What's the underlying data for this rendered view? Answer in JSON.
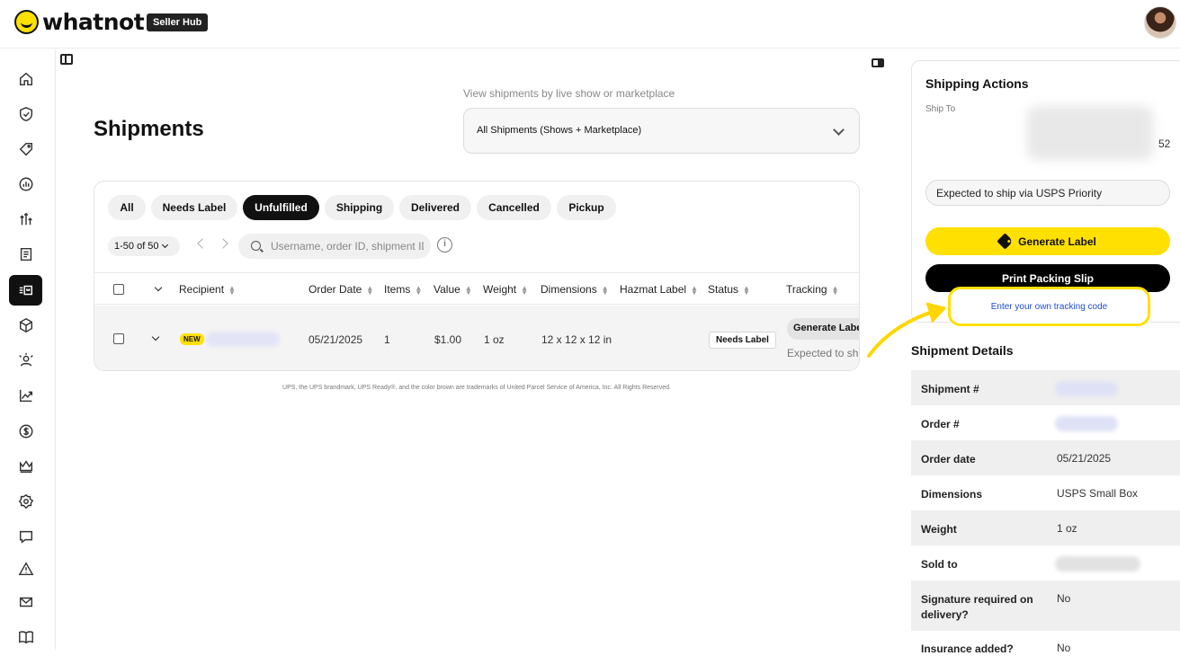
{
  "app": {
    "logo_text": "whatnot",
    "badge": "Seller Hub"
  },
  "sidebar": {
    "items": [
      {
        "icon": "home-icon"
      },
      {
        "icon": "shield-check-icon"
      },
      {
        "icon": "tag-icon"
      },
      {
        "icon": "chart-circle-icon"
      },
      {
        "icon": "arrows-up-icon"
      },
      {
        "icon": "receipt-icon"
      },
      {
        "icon": "shipments-icon",
        "active": true
      },
      {
        "icon": "box-icon"
      },
      {
        "icon": "users-icon"
      },
      {
        "icon": "trend-up-icon"
      },
      {
        "icon": "dollar-icon"
      },
      {
        "icon": "crown-icon"
      },
      {
        "icon": "gear-icon"
      },
      {
        "icon": "chat-icon"
      },
      {
        "icon": "warning-icon"
      },
      {
        "icon": "mail-icon"
      },
      {
        "icon": "book-icon"
      }
    ]
  },
  "main": {
    "title": "Shipments",
    "filter": {
      "label": "View shipments by live show or marketplace",
      "selected": "All Shipments (Shows + Marketplace)"
    },
    "tabs": [
      {
        "label": "All"
      },
      {
        "label": "Needs Label"
      },
      {
        "label": "Unfulfilled",
        "active": true
      },
      {
        "label": "Shipping"
      },
      {
        "label": "Delivered"
      },
      {
        "label": "Cancelled"
      },
      {
        "label": "Pickup"
      }
    ],
    "range": "1-50 of 50",
    "search_placeholder": "Username, order ID, shipment ID",
    "info_glyph": "i",
    "columns": {
      "recipient": "Recipient",
      "order_date": "Order Date",
      "items": "Items",
      "value": "Value",
      "weight": "Weight",
      "dimensions": "Dimensions",
      "hazmat": "Hazmat Label",
      "status": "Status",
      "tracking": "Tracking"
    },
    "row": {
      "badge": "NEW",
      "order_date": "05/21/2025",
      "items": "1",
      "value": "$1.00",
      "weight": "1 oz",
      "dimensions": "12 x 12 x 12 in",
      "status": "Needs Label",
      "tracking_button": "Generate Label",
      "tracking_note": "Expected to ship via USPS Priority"
    },
    "disclaimer": "UPS, the UPS brandmark, UPS Ready®, and the color brown are trademarks of United Parcel Service of America, Inc. All Rights Reserved."
  },
  "panel": {
    "actions_title": "Shipping Actions",
    "ship_to_label": "Ship To",
    "ship_to_suffix": "52",
    "expected": "Expected to ship via USPS Priority",
    "generate_label": "Generate Label",
    "print_slip": "Print Packing Slip",
    "tracking_link": "Enter your own tracking code",
    "accent_color": "#ffe000",
    "details_title": "Shipment Details",
    "details": [
      {
        "label": "Shipment #",
        "value": ""
      },
      {
        "label": "Order #",
        "value": ""
      },
      {
        "label": "Order date",
        "value": "05/21/2025"
      },
      {
        "label": "Dimensions",
        "value": "USPS Small Box"
      },
      {
        "label": "Weight",
        "value": "1 oz"
      },
      {
        "label": "Sold to",
        "value": ""
      },
      {
        "label": "Signature required on delivery?",
        "value": "No"
      },
      {
        "label": "Insurance added?",
        "value": "No"
      }
    ]
  }
}
